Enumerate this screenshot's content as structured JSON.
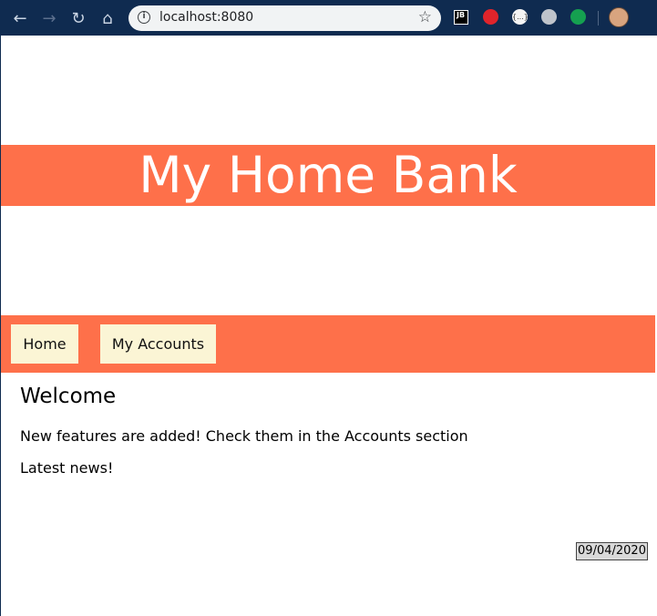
{
  "browser": {
    "url": "localhost:8080",
    "back_icon": "arrow-left-icon",
    "forward_icon": "arrow-right-icon",
    "reload_icon": "reload-icon",
    "home_icon": "home-icon",
    "info_icon": "info-icon",
    "star_icon": "star-icon",
    "extensions": [
      {
        "name": "jetbrains-extension-icon",
        "label": "JB"
      },
      {
        "name": "stop-extension-icon"
      },
      {
        "name": "json-extension-icon",
        "label": "{...}"
      },
      {
        "name": "gear-extension-icon"
      },
      {
        "name": "green-extension-icon"
      },
      {
        "name": "profile-avatar-icon"
      }
    ],
    "accent_color": "#0f2b50"
  },
  "site": {
    "title": "My Home Bank",
    "brand_color": "#fe704a",
    "nav": {
      "items": [
        {
          "label": "Home"
        },
        {
          "label": "My Accounts"
        }
      ],
      "item_background": "#fbf5d5"
    }
  },
  "content": {
    "heading": "Welcome",
    "paragraphs": [
      "New features are added! Check them in the Accounts section",
      "Latest news!"
    ],
    "date": "09/04/2020"
  }
}
